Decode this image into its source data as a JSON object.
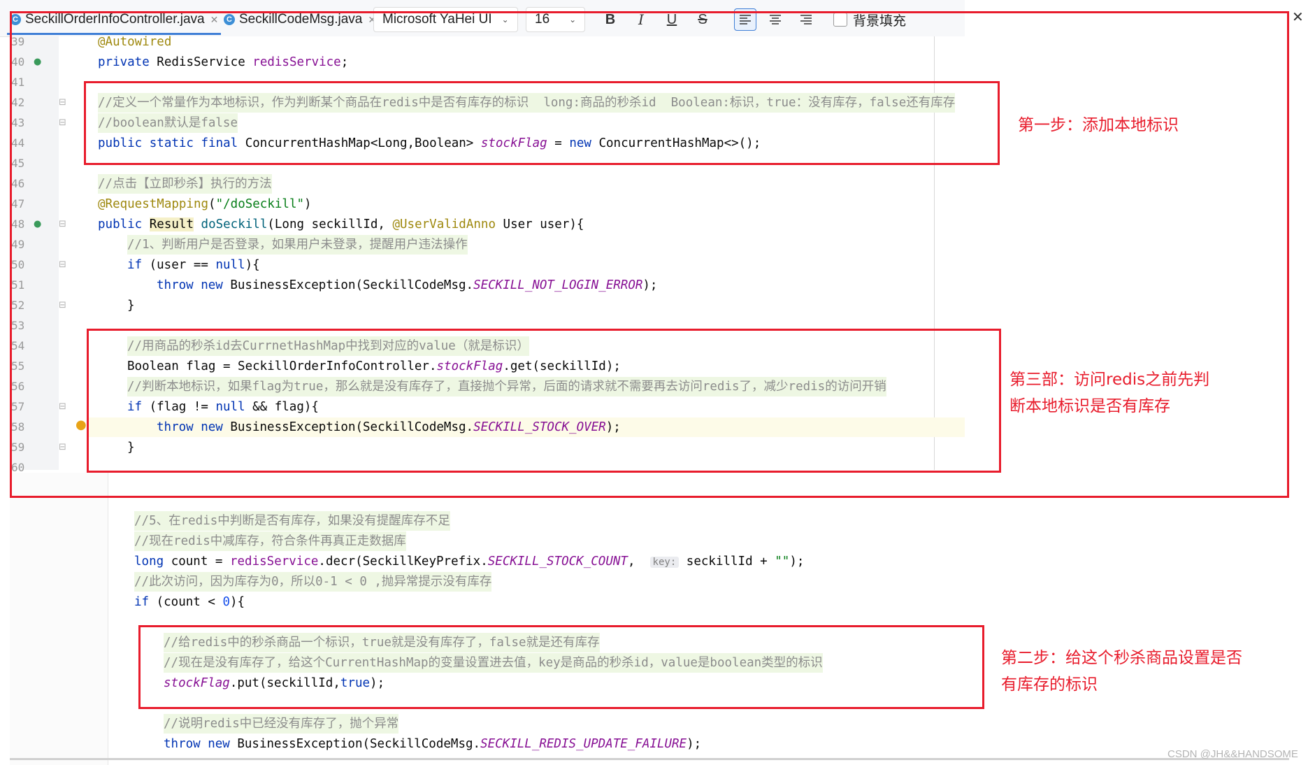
{
  "tabs": [
    {
      "label": "SeckillOrderInfoController.java",
      "icon": "java-class-icon",
      "active": true
    },
    {
      "label": "SeckillCodeMsg.java",
      "icon": "java-class-icon",
      "active": false
    }
  ],
  "toolbar": {
    "font_family": "Microsoft YaHei UI",
    "font_size": "16",
    "bold": "B",
    "italic": "I",
    "underline": "U",
    "strike": "S",
    "fill_label": "背景填充"
  },
  "close_glyph": "✕",
  "code_top": [
    {
      "n": "39",
      "text": "@Autowired"
    },
    {
      "n": "40",
      "text": "private RedisService redisService;"
    },
    {
      "n": "41",
      "text": ""
    },
    {
      "n": "42",
      "text": "//定义一个常量作为本地标识，作为判断某个商品在redis中是否有库存的标识  long:商品的秒杀id  Boolean:标识，true：没有库存，false还有库存"
    },
    {
      "n": "43",
      "text": "//boolean默认是false"
    },
    {
      "n": "44",
      "text": "public static final ConcurrentHashMap<Long,Boolean> stockFlag = new ConcurrentHashMap<>();"
    },
    {
      "n": "45",
      "text": ""
    },
    {
      "n": "46",
      "text": "//点击【立即秒杀】执行的方法"
    },
    {
      "n": "47",
      "text": "@RequestMapping(\"/doSeckill\")"
    },
    {
      "n": "48",
      "text": "public Result doSeckill(Long seckillId, @UserValidAnno User user){"
    },
    {
      "n": "49",
      "text": "//1、判断用户是否登录，如果用户未登录，提醒用户违法操作"
    },
    {
      "n": "50",
      "text": "if (user == null){"
    },
    {
      "n": "51",
      "text": "throw new BusinessException(SeckillCodeMsg.SECKILL_NOT_LOGIN_ERROR);"
    },
    {
      "n": "52",
      "text": "}"
    },
    {
      "n": "53",
      "text": ""
    },
    {
      "n": "54",
      "text": "//用商品的秒杀id去CurrnetHashMap中找到对应的value（就是标识）"
    },
    {
      "n": "55",
      "text": "Boolean flag = SeckillOrderInfoController.stockFlag.get(seckillId);"
    },
    {
      "n": "56",
      "text": "//判断本地标识，如果flag为true，那么就是没有库存了，直接抛个异常，后面的请求就不需要再去访问redis了，减少redis的访问开销"
    },
    {
      "n": "57",
      "text": "if (flag != null && flag){"
    },
    {
      "n": "58",
      "text": "throw new BusinessException(SeckillCodeMsg.SECKILL_STOCK_OVER);"
    },
    {
      "n": "59",
      "text": "}"
    },
    {
      "n": "60",
      "text": ""
    }
  ],
  "code_bottom": [
    {
      "text": "//5、在redis中判断是否有库存，如果没有提醒库存不足"
    },
    {
      "text": "//现在redis中减库存，符合条件再真正走数据库"
    },
    {
      "text": "long count = redisService.decr(SeckillKeyPrefix.SECKILL_STOCK_COUNT,  key: seckillId + \"\");"
    },
    {
      "text": "//此次访问，因为库存为0，所以0-1 < 0 ,抛异常提示没有库存"
    },
    {
      "text": "if (count < 0){"
    },
    {
      "text": "//给redis中的秒杀商品一个标识，true就是没有库存了，false就是还有库存"
    },
    {
      "text": "//现在是没有库存了，给这个CurrentHashMap的变量设置进去值，key是商品的秒杀id，value是boolean类型的标识"
    },
    {
      "text": "stockFlag.put(seckillId,true);"
    },
    {
      "text": "//说明redis中已经没有库存了，抛个异常"
    },
    {
      "text": "throw new BusinessException(SeckillCodeMsg.SECKILL_REDIS_UPDATE_FAILURE);"
    }
  ],
  "notes": {
    "step1": "第一步：添加本地标识",
    "step3_line1": "第三部：访问redis之前先判",
    "step3_line2": "断本地标识是否有库存",
    "step2_line1": "第二步：给这个秒杀商品设置是否",
    "step2_line2": "有库存的标识"
  },
  "watermark": "CSDN @JH&&HANDSOME",
  "colors": {
    "annotation_red": "#e81c2c",
    "comment_bg": "#eef7e3",
    "keyword": "#0033b3",
    "field": "#871094",
    "annotation": "#9e880d"
  }
}
